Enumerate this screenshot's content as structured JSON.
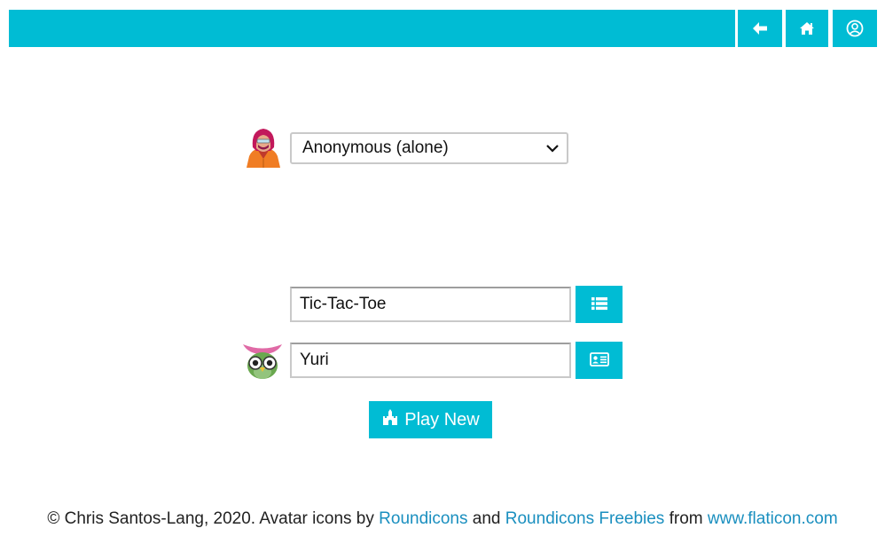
{
  "nav": {
    "back_icon": "arrow-left-icon",
    "home_icon": "home-icon",
    "account_icon": "user-circle-icon"
  },
  "player_select": {
    "avatar_icon": "hooded-person-avatar-icon",
    "selected": "Anonymous (alone)"
  },
  "game_field": {
    "value": "Tic-Tac-Toe",
    "button_icon": "list-icon"
  },
  "name_field": {
    "value": "Yuri",
    "avatar_icon": "owl-avatar-icon",
    "button_icon": "id-card-icon"
  },
  "play_button": {
    "label": "Play New",
    "icon": "castle-icon"
  },
  "footer": {
    "text_before": "© Chris Santos-Lang, 2020. Avatar icons by ",
    "link1": "Roundicons",
    "and": " and ",
    "link2": "Roundicons Freebies",
    "from": " from ",
    "link3": "www.flaticon.com"
  },
  "colors": {
    "accent": "#00bcd4",
    "link": "#1a8fbf"
  }
}
